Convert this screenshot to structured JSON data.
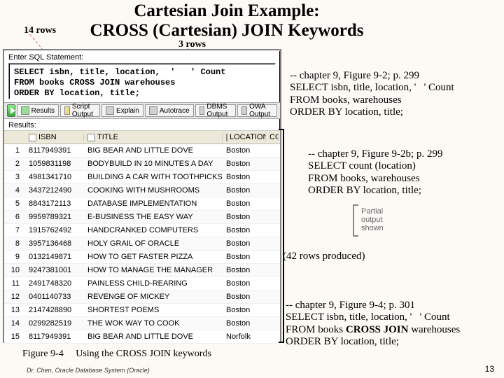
{
  "title": {
    "line1": "Cartesian Join Example:",
    "line2": "CROSS (Cartesian) JOIN Keywords"
  },
  "annotations": {
    "rows14": "14 rows",
    "rows3": "3 rows"
  },
  "sql_panel": {
    "enter_label": "Enter SQL Statement:",
    "editor_text": "SELECT isbn, title, location,  '   ' Count\nFROM books CROSS JOIN warehouses\nORDER BY location, title;",
    "tabs": {
      "results": "Results",
      "script": "Script Output",
      "explain": "Explain",
      "autotrace": "Autotrace",
      "dbms": "DBMS Output",
      "owa": "OWA Output"
    },
    "results_label": "Results:",
    "columns": {
      "isbn": "ISBN",
      "title": "TITLE",
      "location": "LOCATION",
      "count": "COUNT"
    },
    "rows": [
      {
        "n": "1",
        "isbn": "8117949391",
        "title": "BIG BEAR AND LITTLE DOVE",
        "loc": "Boston"
      },
      {
        "n": "2",
        "isbn": "1059831198",
        "title": "BODYBUILD IN 10 MINUTES A DAY",
        "loc": "Boston"
      },
      {
        "n": "3",
        "isbn": "4981341710",
        "title": "BUILDING A CAR WITH TOOTHPICKS",
        "loc": "Boston"
      },
      {
        "n": "4",
        "isbn": "3437212490",
        "title": "COOKING WITH MUSHROOMS",
        "loc": "Boston"
      },
      {
        "n": "5",
        "isbn": "8843172113",
        "title": "DATABASE IMPLEMENTATION",
        "loc": "Boston"
      },
      {
        "n": "6",
        "isbn": "9959789321",
        "title": "E-BUSINESS THE EASY WAY",
        "loc": "Boston"
      },
      {
        "n": "7",
        "isbn": "1915762492",
        "title": "HANDCRANKED COMPUTERS",
        "loc": "Boston"
      },
      {
        "n": "8",
        "isbn": "3957136468",
        "title": "HOLY GRAIL OF ORACLE",
        "loc": "Boston"
      },
      {
        "n": "9",
        "isbn": "0132149871",
        "title": "HOW TO GET FASTER PIZZA",
        "loc": "Boston"
      },
      {
        "n": "10",
        "isbn": "9247381001",
        "title": "HOW TO MANAGE THE MANAGER",
        "loc": "Boston"
      },
      {
        "n": "11",
        "isbn": "2491748320",
        "title": "PAINLESS CHILD-REARING",
        "loc": "Boston"
      },
      {
        "n": "12",
        "isbn": "0401140733",
        "title": "REVENGE OF MICKEY",
        "loc": "Boston"
      },
      {
        "n": "13",
        "isbn": "2147428890",
        "title": "SHORTEST POEMS",
        "loc": "Boston"
      },
      {
        "n": "14",
        "isbn": "0299282519",
        "title": "THE WOK WAY TO COOK",
        "loc": "Boston"
      },
      {
        "n": "15",
        "isbn": "8117949391",
        "title": "BIG BEAR AND LITTLE DOVE",
        "loc": "Norfolk"
      }
    ]
  },
  "sql_blocks": {
    "b1": {
      "l1": "-- chapter 9, Figure 9-2; p. 299",
      "l2a": "SELECT isbn, title, location, '",
      "l2b": "' Count",
      "l3": "FROM books, warehouses",
      "l4": "ORDER BY location, title;"
    },
    "b2": {
      "l1": "-- chapter 9, Figure 9-2b; p. 299",
      "l2": "SELECT count (location)",
      "l3": "FROM books, warehouses",
      "l4": "ORDER BY location, title;"
    },
    "b3": {
      "l1": "-- chapter 9, Figure 9-4; p. 301",
      "l2a": "SELECT isbn, title, location, '",
      "l2b": "' Count",
      "l3a": "FROM books ",
      "l3b": "CROSS JOIN",
      "l3c": " warehouses",
      "l4": "ORDER BY location, title;"
    }
  },
  "partial": {
    "l1": "Partial",
    "l2": "output",
    "l3": "shown"
  },
  "rows_produced": "(42 rows produced)",
  "figure_caption": {
    "num": "Figure 9-4",
    "text": "Using the CROSS JOIN keywords"
  },
  "footnote": "Dr. Chen, Oracle Database System (Oracle)",
  "page_num": "13"
}
